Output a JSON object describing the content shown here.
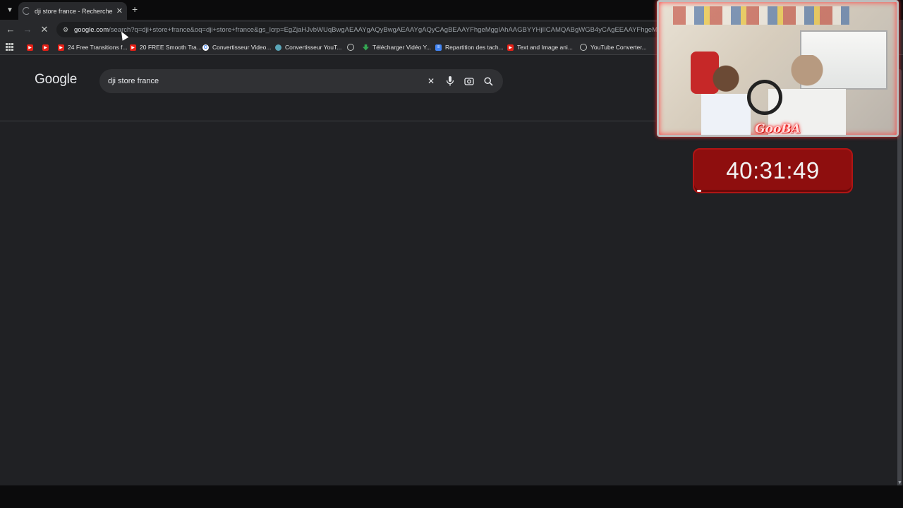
{
  "tab": {
    "title": "dji store france - Recherche Go",
    "new_tab_symbol": "+"
  },
  "toolbar": {
    "url_domain": "google.com",
    "url_path": "/search?q=dji+store+france&oq=dji+store+france&gs_lcrp=EgZjaHJvbWUqBwgAEAAYgAQyBwgAEAAYgAQyCAgBEAAYFhgeMggIAhAAGBYYHjIICAMQABgWGB4yCAgEEAAYFhgeMggIBRA"
  },
  "bookmarks": [
    {
      "label": "",
      "icon": "youtube-icon"
    },
    {
      "label": "",
      "icon": "youtube-icon"
    },
    {
      "label": "24 Free Transitions f...",
      "icon": "youtube-icon"
    },
    {
      "label": "20 FREE Smooth Tra...",
      "icon": "youtube-icon"
    },
    {
      "label": "Convertisseur Video...",
      "icon": "google-icon"
    },
    {
      "label": "Convertisseur YouT...",
      "icon": "converter-icon"
    },
    {
      "label": "",
      "icon": "globe-icon"
    },
    {
      "label": "Télécharger Vidéo Y...",
      "icon": "download-icon"
    },
    {
      "label": "Repartition des tach...",
      "icon": "docs-icon"
    },
    {
      "label": "Text and Image ani...",
      "icon": "youtube-icon"
    },
    {
      "label": "YouTube Converter...",
      "icon": "globe-icon"
    }
  ],
  "google": {
    "logo": "Google",
    "query": "dji store france"
  },
  "overlay": {
    "webcam_label": "GooBA",
    "timer": "40:31:49",
    "accent_color": "#8e0e0e"
  }
}
